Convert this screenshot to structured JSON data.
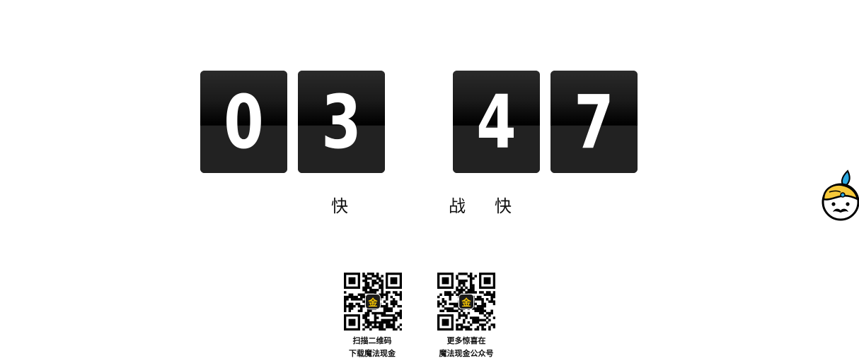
{
  "countdown": {
    "digits": [
      "0",
      "3",
      "4",
      "7"
    ]
  },
  "labels": {
    "left": "快",
    "right_1": "战",
    "right_2": "快"
  },
  "qr": [
    {
      "logo": "金",
      "caption_line1": "扫描二维码",
      "caption_line2": "下载魔法现金"
    },
    {
      "logo": "金",
      "caption_line1": "更多惊喜在",
      "caption_line2": "魔法现金公众号"
    }
  ],
  "colors": {
    "card": "#222222",
    "digit": "#ffffff",
    "logo_accent": "#f5c400",
    "mascot_hair": "#f7c93a",
    "mascot_leaf": "#2aa8e0"
  },
  "icons": {
    "mascot": "mascot-icon"
  }
}
